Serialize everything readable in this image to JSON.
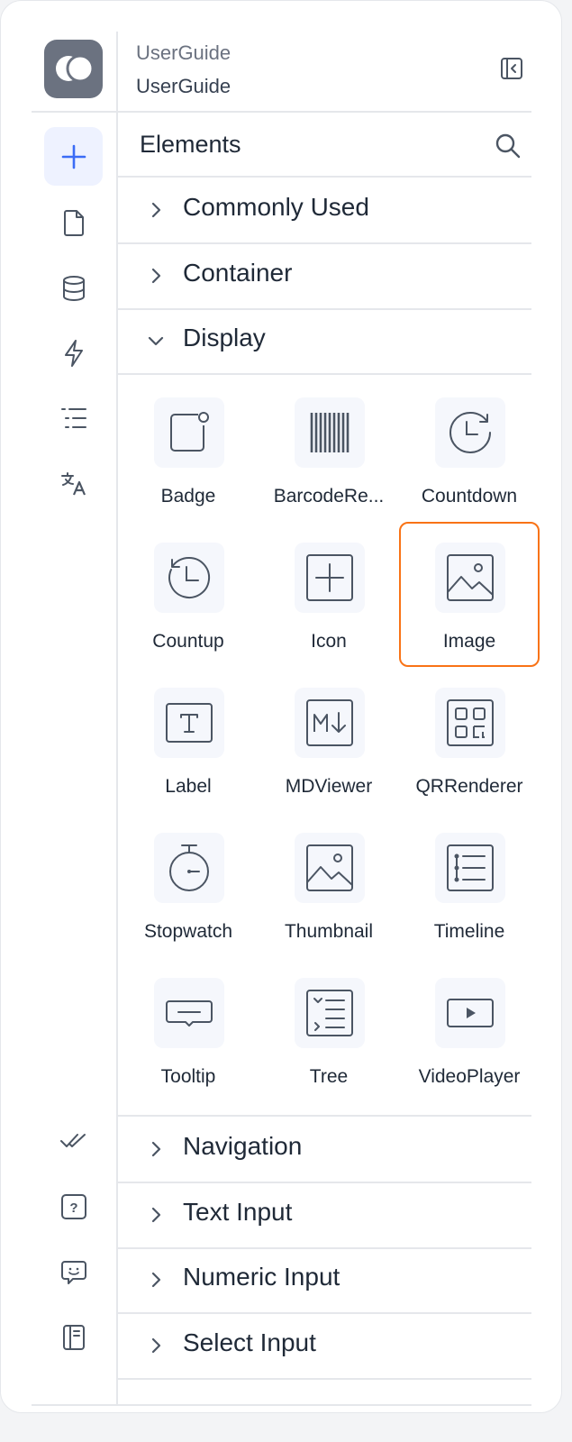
{
  "header": {
    "app_name": "UserGuide",
    "page_name": "UserGuide"
  },
  "panel": {
    "title": "Elements"
  },
  "rail": {
    "top_icons": [
      "plus-icon",
      "page-icon",
      "database-icon",
      "lightning-icon",
      "list-icon",
      "translate-icon"
    ],
    "bottom_icons": [
      "double-check-icon",
      "help-icon",
      "feedback-icon",
      "docs-icon"
    ]
  },
  "sections_top": [
    {
      "label": "Commonly Used",
      "expanded": false
    },
    {
      "label": "Container",
      "expanded": false
    },
    {
      "label": "Display",
      "expanded": true
    }
  ],
  "display_items": [
    {
      "label": "Badge",
      "icon": "badge-icon"
    },
    {
      "label": "BarcodeRe...",
      "icon": "barcode-icon"
    },
    {
      "label": "Countdown",
      "icon": "countdown-icon"
    },
    {
      "label": "Countup",
      "icon": "countup-icon"
    },
    {
      "label": "Icon",
      "icon": "plus-square-icon"
    },
    {
      "label": "Image",
      "icon": "image-icon",
      "selected": true
    },
    {
      "label": "Label",
      "icon": "text-label-icon"
    },
    {
      "label": "MDViewer",
      "icon": "markdown-icon"
    },
    {
      "label": "QRRenderer",
      "icon": "qr-code-icon"
    },
    {
      "label": "Stopwatch",
      "icon": "stopwatch-icon"
    },
    {
      "label": "Thumbnail",
      "icon": "thumbnail-icon"
    },
    {
      "label": "Timeline",
      "icon": "timeline-icon"
    },
    {
      "label": "Tooltip",
      "icon": "tooltip-icon"
    },
    {
      "label": "Tree",
      "icon": "tree-icon"
    },
    {
      "label": "VideoPlayer",
      "icon": "video-player-icon"
    }
  ],
  "sections_bottom": [
    {
      "label": "Navigation",
      "expanded": false
    },
    {
      "label": "Text Input",
      "expanded": false
    },
    {
      "label": "Numeric Input",
      "expanded": false
    },
    {
      "label": "Select Input",
      "expanded": false
    }
  ],
  "colors": {
    "accent": "#3b6cf6",
    "highlight": "#f97316",
    "tile_bg": "#f5f7fc",
    "icon": "#4b5563"
  }
}
